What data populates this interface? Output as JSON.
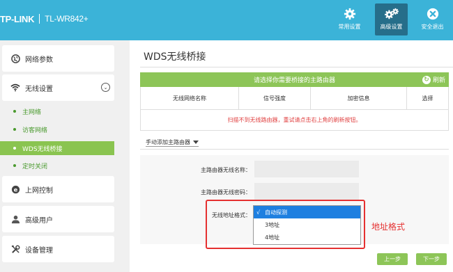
{
  "header": {
    "brand": "TP-LINK",
    "model": "TL-WR842+",
    "nav": [
      {
        "label": "常用设置",
        "icon": "gear-icon"
      },
      {
        "label": "高级设置",
        "icon": "gears-icon"
      },
      {
        "label": "安全退出",
        "icon": "close-circle-icon"
      }
    ]
  },
  "sidebar": {
    "items": [
      {
        "label": "网络参数",
        "icon": "globe-icon"
      },
      {
        "label": "无线设置",
        "icon": "wifi-icon"
      },
      {
        "label": "上网控制",
        "icon": "ie-icon"
      },
      {
        "label": "高级用户",
        "icon": "user-icon"
      },
      {
        "label": "设备管理",
        "icon": "tools-icon"
      }
    ],
    "wireless_sub": [
      "主网络",
      "访客网络",
      "WDS无线桥接",
      "定时关闭"
    ]
  },
  "main": {
    "title": "WDS无线桥接",
    "scan_bar": "请选择你需要桥接的主路由器",
    "refresh": "刷新",
    "columns": [
      "无线网络名称",
      "信号强度",
      "加密信息",
      "选择"
    ],
    "empty_msg": "扫描不到无线路由器，重试请点击右上角的刷新按钮。",
    "manual_add": "手动添加主路由器",
    "form": {
      "ssid_label": "主路由器无线名称：",
      "ssid_value": "",
      "pwd_label": "主路由器无线密码：",
      "pwd_value": "",
      "addr_label": "无线地址格式：",
      "addr_options": [
        "自动探测",
        "3地址",
        "4地址"
      ],
      "addr_selected_mark": "√"
    },
    "annotation": "地址格式",
    "prev_button": "上一步",
    "next_button": "下一步"
  },
  "colors": {
    "header": "#3bb3d8",
    "accent_green": "#8dc558",
    "annotation_red": "#e53030"
  }
}
